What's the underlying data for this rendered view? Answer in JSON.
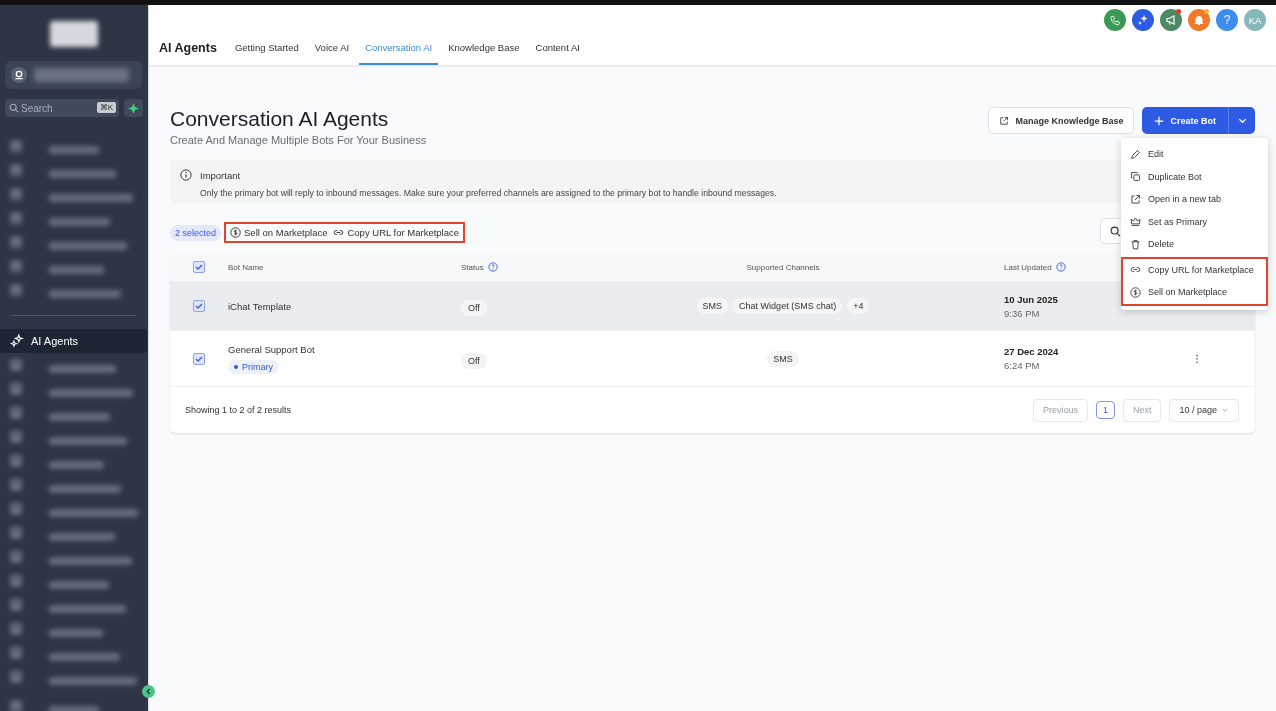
{
  "sidebar": {
    "logo": {
      "kind": "redacted"
    },
    "account": {
      "kind": "redacted"
    },
    "search": {
      "placeholder": "Search",
      "shortcut": "⌘K"
    },
    "top_items": [
      {
        "kind": "redacted",
        "selected": false
      },
      {
        "kind": "redacted",
        "selected": false
      },
      {
        "kind": "redacted",
        "selected": false
      },
      {
        "kind": "redacted",
        "selected": false
      },
      {
        "kind": "redacted",
        "selected": false
      },
      {
        "kind": "redacted",
        "selected": false
      },
      {
        "kind": "redacted",
        "selected": false
      }
    ],
    "items": [
      {
        "kind": "link",
        "label": "AI Agents",
        "selected": true
      },
      {
        "kind": "redacted",
        "selected": false
      },
      {
        "kind": "redacted",
        "selected": false
      },
      {
        "kind": "redacted",
        "selected": false
      },
      {
        "kind": "redacted",
        "selected": false
      },
      {
        "kind": "redacted",
        "selected": false
      },
      {
        "kind": "redacted",
        "selected": false
      },
      {
        "kind": "redacted",
        "selected": false
      },
      {
        "kind": "redacted",
        "selected": false
      },
      {
        "kind": "redacted",
        "selected": false
      },
      {
        "kind": "redacted",
        "selected": false
      },
      {
        "kind": "redacted",
        "selected": false
      },
      {
        "kind": "redacted",
        "selected": false
      },
      {
        "kind": "redacted",
        "selected": false
      },
      {
        "kind": "redacted",
        "selected": false
      }
    ],
    "footer_items": [
      {
        "kind": "redacted",
        "selected": false
      }
    ]
  },
  "header": {
    "title": "AI Agents",
    "tabs": [
      {
        "label": "Getting Started",
        "selected": false
      },
      {
        "label": "Voice AI",
        "selected": false
      },
      {
        "label": "Conversation AI",
        "selected": true
      },
      {
        "label": "Knowledge Base",
        "selected": false
      },
      {
        "label": "Content AI",
        "selected": false
      }
    ],
    "icons": [
      {
        "kind": "phone",
        "color": "#3a9a55",
        "badge": false
      },
      {
        "kind": "sparkle",
        "color": "#2d5be3",
        "badge": false
      },
      {
        "kind": "megaphone",
        "color": "#4b8a63",
        "badge": true
      },
      {
        "kind": "bell",
        "color": "#f07a2a",
        "badge": true
      },
      {
        "kind": "help",
        "color": "#3b8ef0",
        "badge": false,
        "label": "?"
      }
    ],
    "avatar": "KA"
  },
  "page": {
    "title": "Conversation AI Agents",
    "subtitle": "Create And Manage Multiple Bots For Your Business",
    "manage_button": "Manage Knowledge Base",
    "create_button": "Create Bot"
  },
  "notice": {
    "title": "Important",
    "text": "Only the primary bot will reply to inbound messages. Make sure your preferred channels are assigned to the primary bot to handle inbound messages."
  },
  "bulk": {
    "count": "2 selected",
    "highlighted": true,
    "actions": [
      {
        "kind": "sell",
        "label": "Sell on Marketplace"
      },
      {
        "kind": "link",
        "label": "Copy URL for Marketplace"
      }
    ]
  },
  "menu": {
    "items": [
      {
        "kind": "edit",
        "label": "Edit",
        "highlighted": false
      },
      {
        "kind": "copy",
        "label": "Duplicate Bot",
        "highlighted": false
      },
      {
        "kind": "external",
        "label": "Open in a new tab",
        "highlighted": false
      },
      {
        "kind": "crown",
        "label": "Set as Primary",
        "highlighted": false
      },
      {
        "kind": "trash",
        "label": "Delete",
        "highlighted": false
      },
      {
        "kind": "link",
        "label": "Copy URL for Marketplace",
        "highlighted": true
      },
      {
        "kind": "sell",
        "label": "Sell on Marketplace",
        "highlighted": true
      }
    ]
  },
  "table": {
    "all_checked": true,
    "columns": [
      "Bot Name",
      "Status",
      "Supported Channels",
      "Last Updated"
    ],
    "rows": [
      {
        "name": "iChat Template",
        "primary": false,
        "status": "Off",
        "channels": [
          "SMS",
          "Chat Widget (SMS chat)",
          "+4"
        ],
        "date": "10 Jun 2025",
        "time": "9:36 PM",
        "checked": true,
        "selected": true
      },
      {
        "name": "General Support Bot",
        "primary": true,
        "primary_label": "Primary",
        "status": "Off",
        "channels": [
          "SMS"
        ],
        "date": "27 Dec 2024",
        "time": "6:24 PM",
        "checked": true,
        "selected": false
      }
    ],
    "summary": "Showing 1 to 2 of 2 results",
    "pagination": {
      "previous": "Previous",
      "pages": [
        {
          "label": "1",
          "selected": true
        }
      ],
      "next": "Next",
      "page_size": "10 / page"
    }
  }
}
